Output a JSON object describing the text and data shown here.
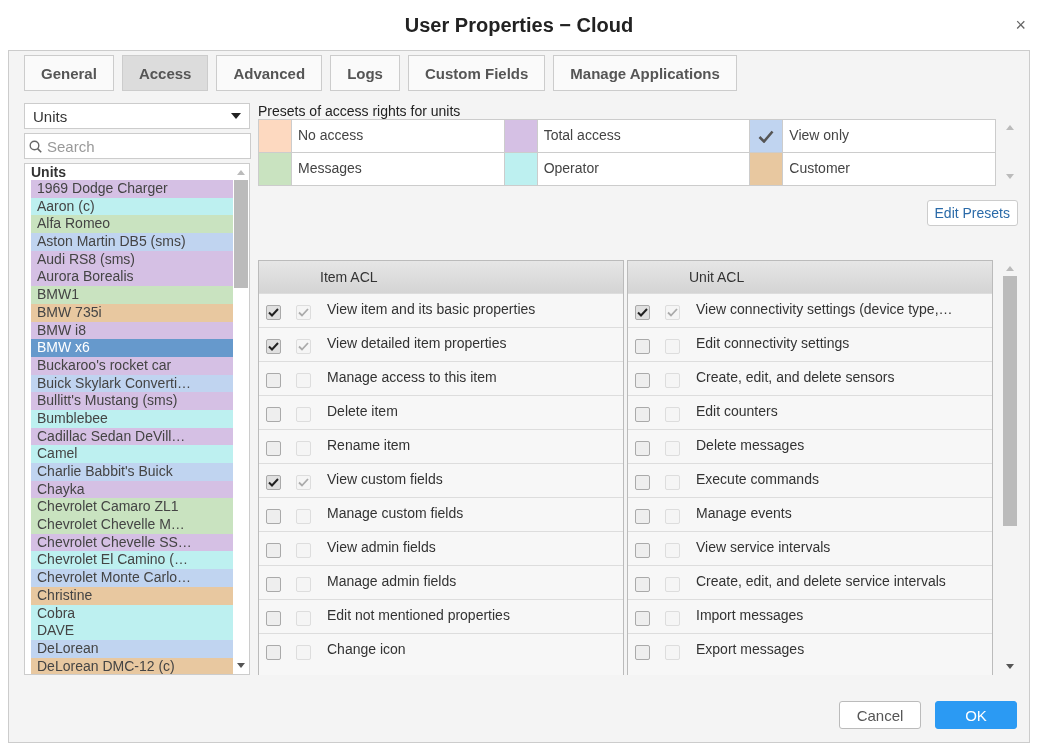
{
  "window": {
    "title": "User Properties − Cloud",
    "close": "×"
  },
  "tabs": [
    {
      "label": "General",
      "selected": false
    },
    {
      "label": "Access",
      "selected": true
    },
    {
      "label": "Advanced",
      "selected": false
    },
    {
      "label": "Logs",
      "selected": false
    },
    {
      "label": "Custom Fields",
      "selected": false
    },
    {
      "label": "Manage Applications",
      "selected": false
    }
  ],
  "sidebar": {
    "type_select": {
      "value": "Units"
    },
    "search": {
      "placeholder": "Search"
    },
    "list_header": "Units",
    "items": [
      {
        "label": "1969 Dodge Charger",
        "color": "#d5c0e4",
        "selected": false
      },
      {
        "label": "Aaron (c)",
        "color": "#bdf0f0",
        "selected": false
      },
      {
        "label": "Alfa Romeo",
        "color": "#c9e3c0",
        "selected": false
      },
      {
        "label": "Aston Martin DB5 (sms)",
        "color": "#c0d4f0",
        "selected": false
      },
      {
        "label": "Audi RS8 (sms)",
        "color": "#d5c0e4",
        "selected": false
      },
      {
        "label": "Aurora Borealis",
        "color": "#d5c0e4",
        "selected": false
      },
      {
        "label": "BMW1",
        "color": "#c9e3c0",
        "selected": false
      },
      {
        "label": "BMW 735i",
        "color": "#e8c8a0",
        "selected": false
      },
      {
        "label": "BMW i8",
        "color": "#d5c0e4",
        "selected": false
      },
      {
        "label": "BMW x6",
        "selected": true
      },
      {
        "label": "Buckaroo's rocket car",
        "color": "#d5c0e4",
        "selected": false
      },
      {
        "label": "Buick Skylark Converti…",
        "color": "#c0d4f0",
        "selected": false
      },
      {
        "label": "Bullitt's Mustang (sms)",
        "color": "#d5c0e4",
        "selected": false
      },
      {
        "label": "Bumblebee",
        "color": "#bdf0f0",
        "selected": false
      },
      {
        "label": "Cadillac Sedan DeVill…",
        "color": "#d5c0e4",
        "selected": false
      },
      {
        "label": "Camel",
        "color": "#bdf0f0",
        "selected": false
      },
      {
        "label": "Charlie Babbit's Buick",
        "color": "#c0d4f0",
        "selected": false
      },
      {
        "label": "Chayka",
        "color": "#d5c0e4",
        "selected": false
      },
      {
        "label": "Chevrolet Camaro ZL1",
        "color": "#c9e3c0",
        "selected": false
      },
      {
        "label": "Chevrolet Chevelle M…",
        "color": "#c9e3c0",
        "selected": false
      },
      {
        "label": "Chevrolet Chevelle SS…",
        "color": "#d5c0e4",
        "selected": false
      },
      {
        "label": "Chevrolet El Camino (…",
        "color": "#bdf0f0",
        "selected": false
      },
      {
        "label": "Chevrolet Monte Carlo…",
        "color": "#c0d4f0",
        "selected": false
      },
      {
        "label": "Christine",
        "color": "#e8c8a0",
        "selected": false
      },
      {
        "label": "Cobra",
        "color": "#bdf0f0",
        "selected": false
      },
      {
        "label": "DAVE",
        "color": "#bdf0f0",
        "selected": false
      },
      {
        "label": "DeLorean",
        "color": "#c0d4f0",
        "selected": false
      },
      {
        "label": "DeLorean DMC-12 (c)",
        "color": "#e8c8a0",
        "selected": false
      }
    ]
  },
  "presets": {
    "title": "Presets of access rights for units",
    "items": [
      {
        "label": "No access",
        "color": "#fdd9c0",
        "selected": false
      },
      {
        "label": "Total access",
        "color": "#d5c0e4",
        "selected": false
      },
      {
        "label": "View only",
        "color": "#c0d4f0",
        "selected": true
      },
      {
        "label": "Messages",
        "color": "#c9e3c0",
        "selected": false
      },
      {
        "label": "Operator",
        "color": "#bdf0f0",
        "selected": false
      },
      {
        "label": "Customer",
        "color": "#e8c8a0",
        "selected": false
      }
    ],
    "edit_button": "Edit Presets"
  },
  "acl_tables": [
    {
      "title": "Item ACL",
      "rows": [
        {
          "label": "View item and its basic properties",
          "checked": true,
          "inherited": true
        },
        {
          "label": "View detailed item properties",
          "checked": true,
          "inherited": true
        },
        {
          "label": "Manage access to this item",
          "checked": false,
          "inherited": false
        },
        {
          "label": "Delete item",
          "checked": false,
          "inherited": false
        },
        {
          "label": "Rename item",
          "checked": false,
          "inherited": false
        },
        {
          "label": "View custom fields",
          "checked": true,
          "inherited": true
        },
        {
          "label": "Manage custom fields",
          "checked": false,
          "inherited": false
        },
        {
          "label": "View admin fields",
          "checked": false,
          "inherited": false
        },
        {
          "label": "Manage admin fields",
          "checked": false,
          "inherited": false
        },
        {
          "label": "Edit not mentioned properties",
          "checked": false,
          "inherited": false
        },
        {
          "label": "Change icon",
          "checked": false,
          "inherited": false
        }
      ]
    },
    {
      "title": "Unit ACL",
      "rows": [
        {
          "label": "View connectivity settings (device type,…",
          "checked": true,
          "inherited": true
        },
        {
          "label": "Edit connectivity settings",
          "checked": false,
          "inherited": false
        },
        {
          "label": "Create, edit, and delete sensors",
          "checked": false,
          "inherited": false
        },
        {
          "label": "Edit counters",
          "checked": false,
          "inherited": false
        },
        {
          "label": "Delete messages",
          "checked": false,
          "inherited": false
        },
        {
          "label": "Execute commands",
          "checked": false,
          "inherited": false
        },
        {
          "label": "Manage events",
          "checked": false,
          "inherited": false
        },
        {
          "label": "View service intervals",
          "checked": false,
          "inherited": false
        },
        {
          "label": "Create, edit, and delete service intervals",
          "checked": false,
          "inherited": false
        },
        {
          "label": "Import messages",
          "checked": false,
          "inherited": false
        },
        {
          "label": "Export messages",
          "checked": false,
          "inherited": false
        }
      ]
    }
  ],
  "buttons": [
    {
      "label": "Cancel",
      "kind": "secondary"
    },
    {
      "label": "OK",
      "kind": "primary"
    }
  ]
}
